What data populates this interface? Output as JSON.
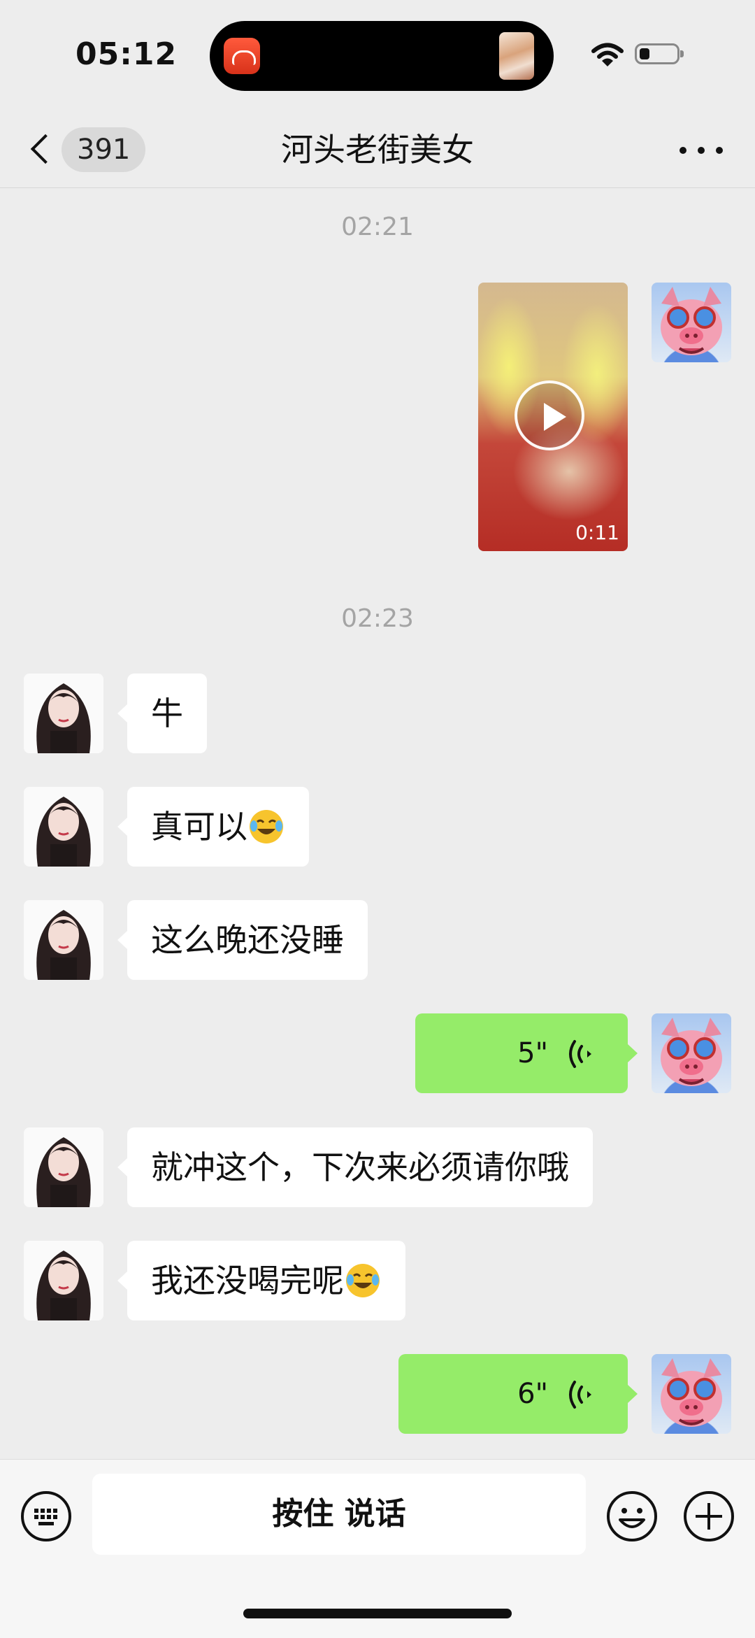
{
  "status": {
    "time": "05:12"
  },
  "nav": {
    "unread_count": "391",
    "title": "河头老街美女"
  },
  "chat": {
    "timestamp_1": "02:21",
    "video_duration": "0:11",
    "timestamp_2": "02:23",
    "messages": [
      {
        "sender": "them",
        "text": "牛"
      },
      {
        "sender": "them",
        "text": "真可以",
        "emoji": "crying-laughing-emoji"
      },
      {
        "sender": "them",
        "text": "这么晚还没睡"
      },
      {
        "sender": "me",
        "voice_duration": "5\""
      },
      {
        "sender": "them",
        "text": "就冲这个，下次来必须请你哦"
      },
      {
        "sender": "them",
        "text": "我还没喝完呢",
        "emoji": "crying-laughing-emoji"
      },
      {
        "sender": "me",
        "voice_duration": "6\""
      }
    ]
  },
  "input": {
    "hold_to_talk": "按住 说话"
  },
  "colors": {
    "background": "#ededed",
    "my_bubble": "#95ec69",
    "their_bubble": "#ffffff"
  },
  "icons": [
    "wifi-icon",
    "battery-icon",
    "back-chevron-icon",
    "more-dots-icon",
    "play-icon",
    "voice-wave-icon",
    "keyboard-icon",
    "emoji-icon",
    "plus-icon"
  ]
}
